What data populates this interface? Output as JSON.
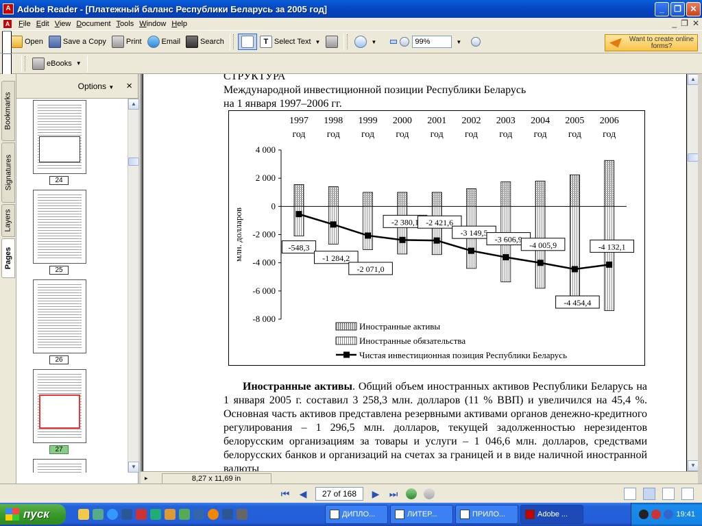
{
  "window": {
    "app_icon": "acrobat-icon",
    "title": "Adobe Reader - [Платежный баланс Республики Беларусь за 2005 год]"
  },
  "menu": [
    "File",
    "Edit",
    "View",
    "Document",
    "Tools",
    "Window",
    "Help"
  ],
  "toolbar": {
    "open": "Open",
    "save_copy": "Save a Copy",
    "print": "Print",
    "email": "Email",
    "search": "Search",
    "select_text": "Select Text",
    "zoom": "99%",
    "promo": "Want to create online forms?"
  },
  "toolbar2": {
    "ebooks": "eBooks"
  },
  "side_tabs": [
    "Bookmarks",
    "Signatures",
    "Layers",
    "Pages"
  ],
  "nav_panel": {
    "options": "Options",
    "close": "×",
    "thumbs": [
      "24",
      "25",
      "26",
      "27"
    ]
  },
  "page": {
    "heading1": "СТРУКТУРА",
    "heading2": "Международной инвестиционной позиции Республики Беларусь",
    "heading3": "на 1 января 1997–2006 гг.",
    "para_bold": "Иностранные активы",
    "para_text": ". Общий объем иностранных активов Республики Беларусь на 1 января 2005 г. составил 3 258,3 млн. долларов (11 % ВВП) и увеличился на 45,4 %. Основная часть активов представлена резервными активами органов денежно-кредитного регулирования – 1 296,5 млн. долларов, текущей задолженностью нерезидентов белорусским организациям за товары и услуги – 1 046,6 млн. долларов, средствами белорусских банков и организаций на счетах за границей и в виде наличной иностранной валюты"
  },
  "chart_data": {
    "type": "bar",
    "categories": [
      "1997",
      "1998",
      "1999",
      "2000",
      "2001",
      "2002",
      "2003",
      "2004",
      "2005",
      "2006"
    ],
    "category_suffix": "год",
    "ylabel": "млн. долларов",
    "ylim": [
      -8000,
      4000
    ],
    "yticks": [
      "4 000",
      "2 000",
      "0",
      "-2 000",
      "-4 000",
      "-6 000",
      "-8 000"
    ],
    "series": [
      {
        "name": "Иностранные активы",
        "kind": "bar",
        "values": [
          1550,
          1400,
          1000,
          1000,
          1000,
          1250,
          1750,
          1800,
          2240,
          3258
        ]
      },
      {
        "name": "Иностранные обязательства",
        "kind": "bar",
        "values": [
          -2100,
          -2680,
          -3070,
          -3380,
          -3420,
          -4400,
          -5360,
          -5810,
          -6700,
          -7390
        ]
      },
      {
        "name": "Чистая инвестиционная позиция Республики Беларусь",
        "kind": "line",
        "values": [
          -548.3,
          -1284.2,
          -2071.0,
          -2380.1,
          -2421.6,
          -3149.5,
          -3606.9,
          -4005.9,
          -4454.4,
          -4132.1
        ]
      }
    ],
    "data_labels": [
      "-548,3",
      "-1 284,2",
      "-2 071,0",
      "-2 380,1",
      "-2 421,6",
      "-3 149,5",
      "-3 606,9",
      "-4 005,9",
      "-4 454,4",
      "-4 132,1"
    ]
  },
  "status": {
    "page_size": "8,27 x 11,69 in",
    "page_indicator": "27 of 168"
  },
  "taskbar": {
    "start": "пуск",
    "tasks": [
      "ДИПЛО...",
      "ЛИТЕР...",
      "ПРИЛО...",
      "Adobe ..."
    ],
    "clock": "19:41"
  }
}
